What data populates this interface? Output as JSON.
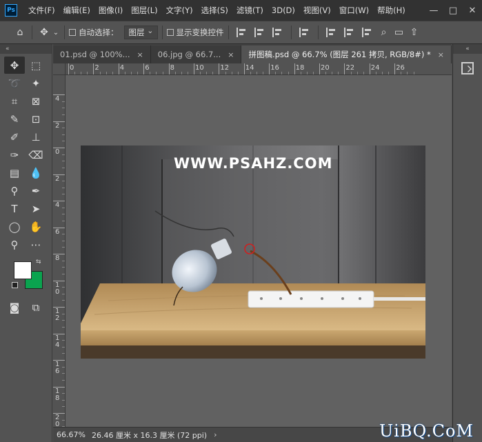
{
  "app": {
    "logo": "Ps",
    "menu": [
      "文件(F)",
      "编辑(E)",
      "图像(I)",
      "图层(L)",
      "文字(Y)",
      "选择(S)",
      "滤镜(T)",
      "3D(D)",
      "视图(V)",
      "窗口(W)",
      "帮助(H)"
    ],
    "window_controls": [
      "—",
      "□",
      "✕"
    ]
  },
  "options": {
    "auto_select_label": "自动选择：",
    "layer_select_value": "图层",
    "show_transform_label": "显示变换控件"
  },
  "panels": {
    "collapse_glyph": "«"
  },
  "tabs": [
    {
      "label": "01.psd @ 100%...",
      "close": "×",
      "active": false
    },
    {
      "label": "06.jpg @ 66.7...",
      "close": "×",
      "active": false
    },
    {
      "label": "拼图稿.psd @ 66.7% (图层 261 拷贝, RGB/8#) *",
      "close": "×",
      "active": true
    }
  ],
  "rulers": {
    "horizontal": [
      "0",
      "2",
      "4",
      "6",
      "8",
      "10",
      "12",
      "14",
      "16",
      "18",
      "20",
      "22",
      "24",
      "26"
    ],
    "vertical": [
      "4",
      "2",
      "0",
      "2",
      "4",
      "6",
      "8",
      "10",
      "12",
      "14",
      "16",
      "18",
      "20"
    ]
  },
  "canvas": {
    "watermark_text": "WWW.PSAHZ.COM"
  },
  "status": {
    "zoom": "66.67%",
    "doc_info": "26.46 厘米 x 16.3 厘米 (72 ppi)",
    "arrow": "›"
  },
  "site_watermark": "UiBQ.CoM",
  "colors": {
    "foreground": "#ffffff",
    "background": "#0aa34f"
  }
}
